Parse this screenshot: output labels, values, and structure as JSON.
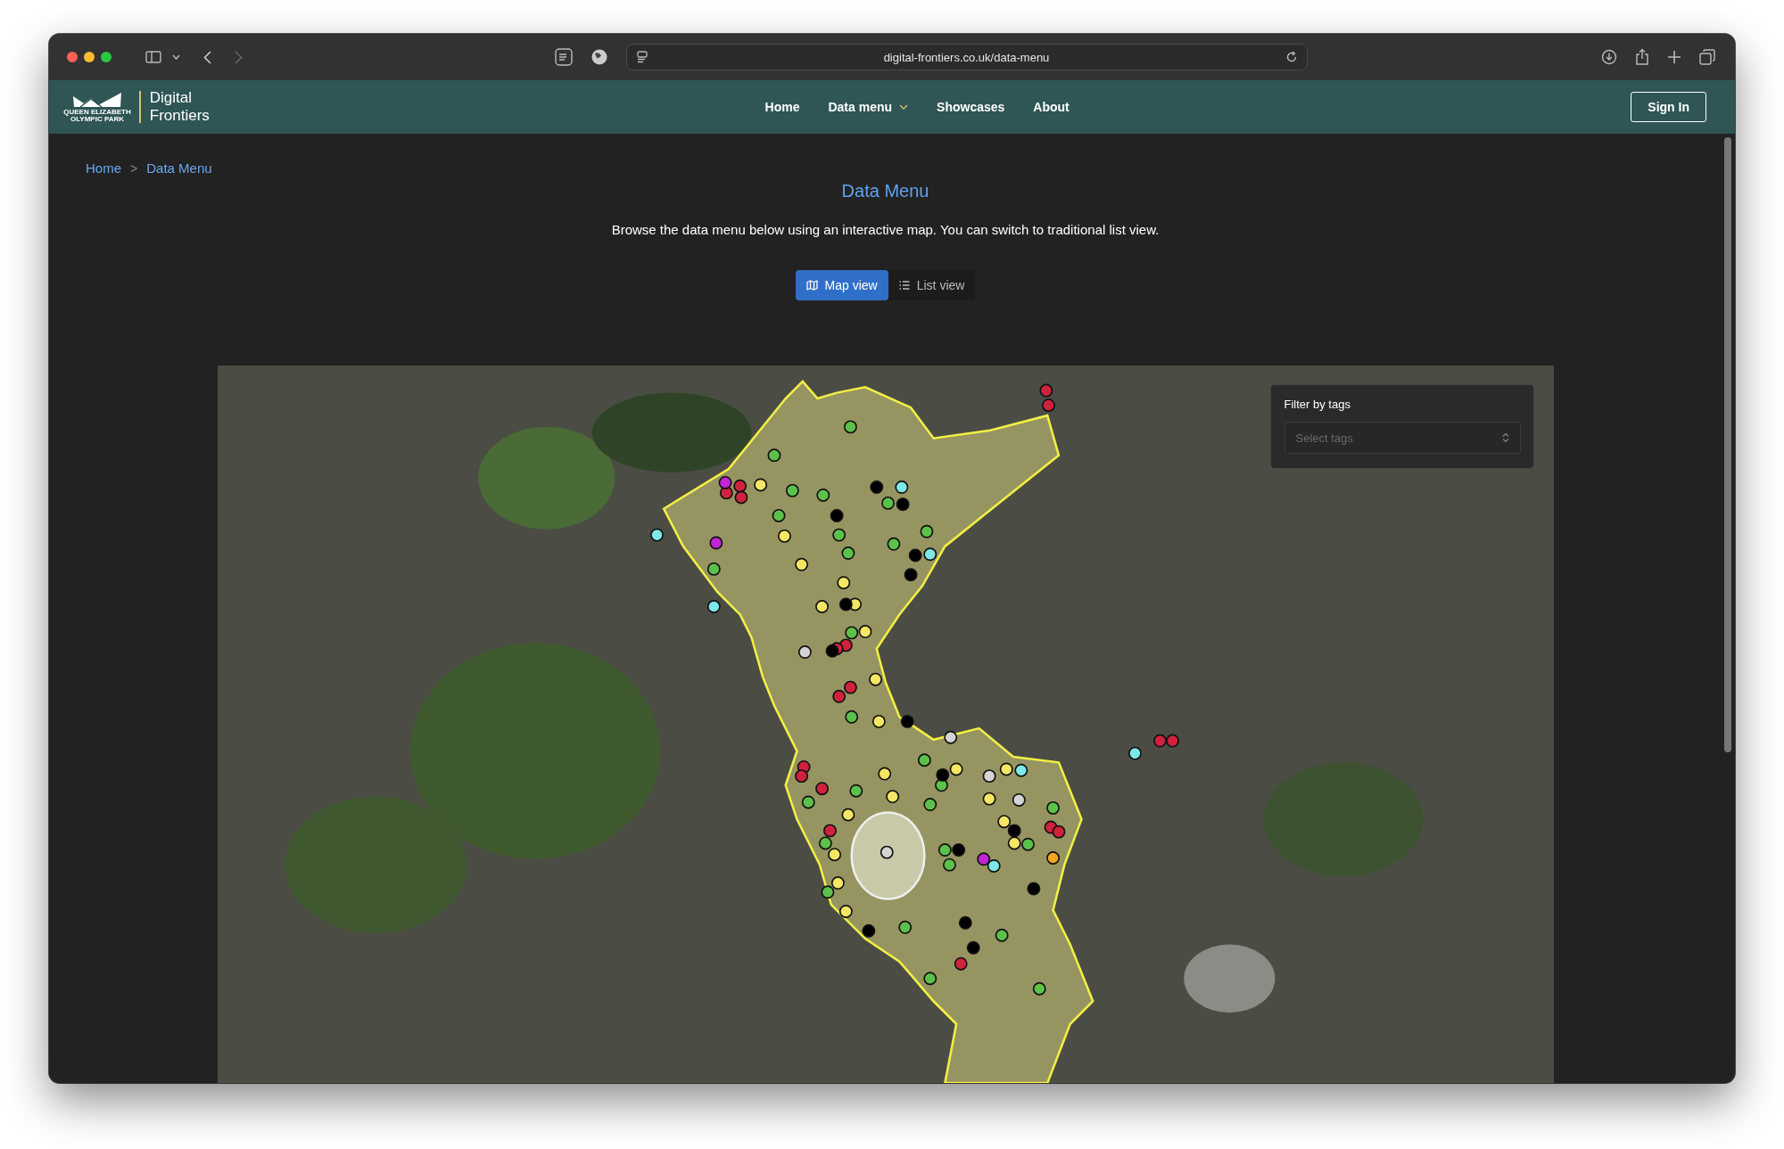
{
  "browser": {
    "url": "digital-frontiers.co.uk/data-menu"
  },
  "navbar": {
    "logo_text": [
      "QUEEN ELIZABETH",
      "OLYMPIC PARK"
    ],
    "brand": "Digital Frontiers",
    "links": [
      {
        "label": "Home",
        "dropdown": false
      },
      {
        "label": "Data menu",
        "dropdown": true
      },
      {
        "label": "Showcases",
        "dropdown": false
      },
      {
        "label": "About",
        "dropdown": false
      }
    ],
    "sign_in": "Sign In"
  },
  "breadcrumb": {
    "items": [
      {
        "label": "Home"
      },
      {
        "label": "Data Menu"
      }
    ],
    "separator": ">"
  },
  "page": {
    "title": "Data Menu",
    "description": "Browse the data menu below using an interactive map. You can switch to traditional list view."
  },
  "view_toggle": [
    {
      "label": "Map view",
      "kind": "map",
      "selected": true
    },
    {
      "label": "List view",
      "kind": "list",
      "selected": false
    }
  ],
  "map": {
    "filter": {
      "label": "Filter by tags",
      "placeholder": "Select tags"
    },
    "markers": [
      {
        "color": "#d0213d"
      },
      {
        "color": "#d0213d"
      },
      {
        "color": "#d0213d"
      },
      {
        "color": "#d0213d"
      },
      {
        "color": "#d0213d"
      },
      {
        "color": "#d0213d"
      },
      {
        "color": "#d0213d"
      },
      {
        "color": "#d0213d"
      },
      {
        "color": "#d0213d"
      },
      {
        "color": "#d0213d"
      },
      {
        "color": "#d0213d"
      },
      {
        "color": "#d0213d"
      },
      {
        "color": "#d0213d"
      },
      {
        "color": "#d0213d"
      },
      {
        "color": "#d0213d"
      },
      {
        "color": "#d0213d"
      },
      {
        "color": "#d0213d"
      },
      {
        "color": "#d0213d"
      },
      {
        "color": "#c026d3"
      },
      {
        "color": "#c026d3"
      },
      {
        "color": "#c026d3"
      },
      {
        "color": "#7ee8e8"
      },
      {
        "color": "#7ee8e8"
      },
      {
        "color": "#7ee8e8"
      },
      {
        "color": "#7ee8e8"
      },
      {
        "color": "#7ee8e8"
      },
      {
        "color": "#7ee8e8"
      },
      {
        "color": "#7ee8e8"
      },
      {
        "color": "#f5e663"
      },
      {
        "color": "#f5e663"
      },
      {
        "color": "#f5e663"
      },
      {
        "color": "#f5e663"
      },
      {
        "color": "#f5e663"
      },
      {
        "color": "#f5e663"
      },
      {
        "color": "#f5e663"
      },
      {
        "color": "#f5e663"
      },
      {
        "color": "#f5e663"
      },
      {
        "color": "#f5e663"
      },
      {
        "color": "#f5e663"
      },
      {
        "color": "#f5e663"
      },
      {
        "color": "#f5e663"
      },
      {
        "color": "#f5e663"
      },
      {
        "color": "#f5e663"
      },
      {
        "color": "#f5e663"
      },
      {
        "color": "#f5e663"
      },
      {
        "color": "#f5e663"
      },
      {
        "color": "#f5e663"
      },
      {
        "color": "#f5e663"
      },
      {
        "color": "#5cc14a"
      },
      {
        "color": "#5cc14a"
      },
      {
        "color": "#5cc14a"
      },
      {
        "color": "#5cc14a"
      },
      {
        "color": "#5cc14a"
      },
      {
        "color": "#5cc14a"
      },
      {
        "color": "#5cc14a"
      },
      {
        "color": "#5cc14a"
      },
      {
        "color": "#5cc14a"
      },
      {
        "color": "#5cc14a"
      },
      {
        "color": "#5cc14a"
      },
      {
        "color": "#5cc14a"
      },
      {
        "color": "#5cc14a"
      },
      {
        "color": "#5cc14a"
      },
      {
        "color": "#5cc14a"
      },
      {
        "color": "#5cc14a"
      },
      {
        "color": "#5cc14a"
      },
      {
        "color": "#5cc14a"
      },
      {
        "color": "#5cc14a"
      },
      {
        "color": "#5cc14a"
      },
      {
        "color": "#5cc14a"
      },
      {
        "color": "#5cc14a"
      },
      {
        "color": "#5cc14a"
      },
      {
        "color": "#5cc14a"
      },
      {
        "color": "#5cc14a"
      },
      {
        "color": "#5cc14a"
      },
      {
        "color": "#5cc14a"
      },
      {
        "color": "#5cc14a"
      },
      {
        "color": "#000000"
      },
      {
        "color": "#000000"
      },
      {
        "color": "#000000"
      },
      {
        "color": "#000000"
      },
      {
        "color": "#000000"
      },
      {
        "color": "#000000"
      },
      {
        "color": "#000000"
      },
      {
        "color": "#000000"
      },
      {
        "color": "#000000"
      },
      {
        "color": "#000000"
      },
      {
        "color": "#000000"
      },
      {
        "color": "#000000"
      },
      {
        "color": "#000000"
      },
      {
        "color": "#000000"
      },
      {
        "color": "#000000"
      },
      {
        "color": "#d4d4d4"
      },
      {
        "color": "#d4d4d4"
      },
      {
        "color": "#d4d4d4"
      },
      {
        "color": "#d4d4d4"
      },
      {
        "color": "#d4d4d4"
      },
      {
        "color": "#f5a623"
      }
    ]
  }
}
